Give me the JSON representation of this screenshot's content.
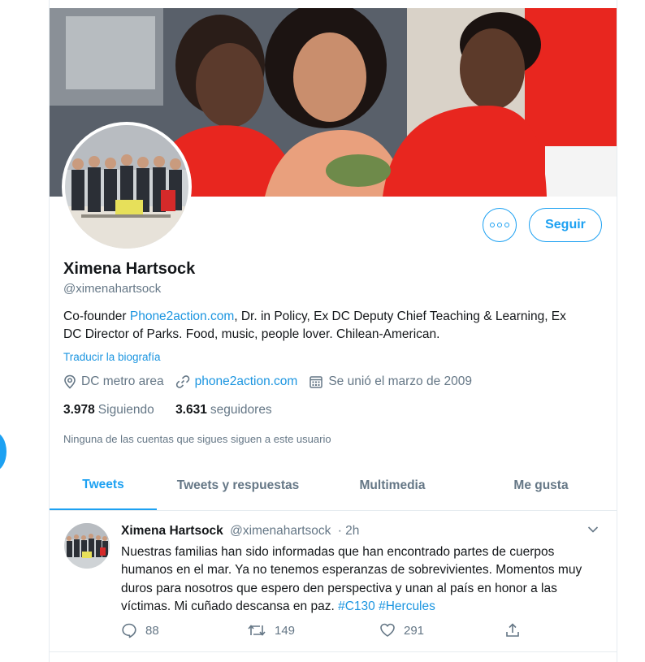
{
  "colors": {
    "accent": "#1da1f2",
    "link": "#1b95e0",
    "muted": "#657786",
    "text": "#14171a"
  },
  "profile": {
    "name": "Ximena Hartsock",
    "handle": "@ximenahartsock",
    "follow_label": "Seguir",
    "more_icon": "more-dots-icon",
    "bio_prefix": "Co-founder ",
    "bio_link": "Phone2action.com",
    "bio_rest": ", Dr. in Policy, Ex DC Deputy Chief Teaching & Learning, Ex DC Director of Parks. Food, music, people lover. Chilean-American.",
    "translate_label": "Traducir la biografía",
    "location": "DC metro area",
    "website": "phone2action.com",
    "joined": "Se unió el marzo de 2009",
    "following_count": "3.978",
    "following_label": "Siguiendo",
    "followers_count": "3.631",
    "followers_label": "seguidores",
    "no_followers_note": "Ninguna de las cuentas que sigues siguen a este usuario"
  },
  "tabs": [
    {
      "label": "Tweets",
      "active": true
    },
    {
      "label": "Tweets y respuestas",
      "active": false
    },
    {
      "label": "Multimedia",
      "active": false
    },
    {
      "label": "Me gusta",
      "active": false
    }
  ],
  "tweet": {
    "author": "Ximena Hartsock",
    "handle": "@ximenahartsock",
    "time": "· 2h",
    "text": "Nuestras familias han sido informadas que han encontrado partes de cuerpos humanos en el mar. Ya no tenemos esperanzas de sobrevivientes. Momentos muy duros para nosotros que espero den perspectiva y unan al país en honor a las víctimas. Mi cuñado descansa en paz. ",
    "hashtags": [
      "#C130",
      "#Hercules"
    ],
    "replies": "88",
    "retweets": "149",
    "likes": "291"
  }
}
